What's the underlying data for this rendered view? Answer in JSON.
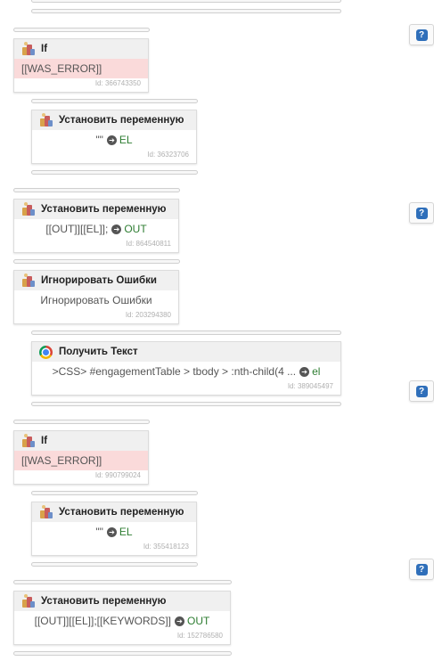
{
  "blocks": [
    {
      "title": "If",
      "body": "[[WAS_ERROR]]",
      "id": "Id: 366743350"
    },
    {
      "title": "Установить переменную",
      "pre": "\"\"",
      "var": "EL",
      "id": "Id: 36323706"
    },
    {
      "title": "Установить переменную",
      "pre": "[[OUT]][[EL]];",
      "var": "OUT",
      "id": "Id: 864540811"
    },
    {
      "title": "Игнорировать Ошибки",
      "body": "Игнорировать Ошибки",
      "id": "Id: 203294380"
    },
    {
      "title": "Получить Текст",
      "pre": ">CSS> #engagementTable > tbody > :nth-child(4 ...",
      "var": "el",
      "id": "Id: 389045497"
    },
    {
      "title": "If",
      "body": "[[WAS_ERROR]]",
      "id": "Id: 990799024"
    },
    {
      "title": "Установить переменную",
      "pre": "\"\"",
      "var": "EL",
      "id": "Id: 355418123"
    },
    {
      "title": "Установить переменную",
      "pre": "[[OUT]][[EL]];[[KEYWORDS]]",
      "var": "OUT",
      "id": "Id: 152786580"
    }
  ],
  "help_glyph": "?",
  "arrow_glyph": "➔",
  "colors": {
    "error_bg": "#fadada",
    "var_green": "#2e7d32",
    "help_blue": "#2f6fba"
  }
}
